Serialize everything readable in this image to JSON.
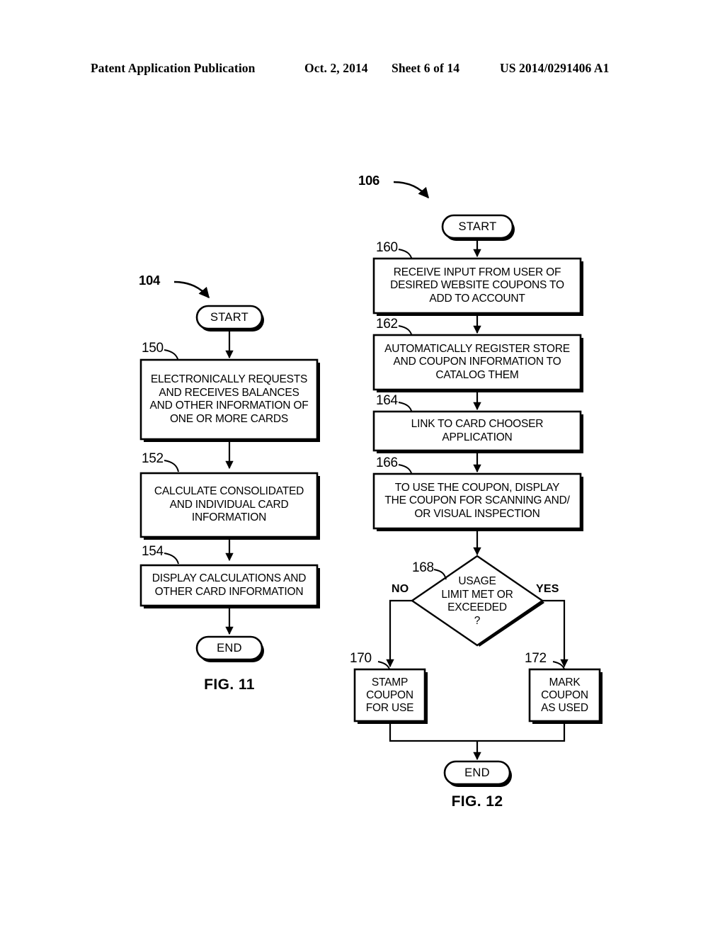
{
  "header": {
    "publication": "Patent Application Publication",
    "date": "Oct. 2, 2014",
    "sheet": "Sheet 6 of 14",
    "patent_number": "US 2014/0291406 A1"
  },
  "figures": [
    {
      "caption": "FIG. 11",
      "diagram_ref": "104",
      "start_label": "START",
      "end_label": "END",
      "steps": [
        {
          "ref": "150",
          "text": "ELECTRONICALLY REQUESTS\nAND RECEIVES BALANCES\nAND OTHER INFORMATION OF\nONE OR MORE CARDS"
        },
        {
          "ref": "152",
          "text": "CALCULATE CONSOLIDATED\nAND INDIVIDUAL CARD\nINFORMATION"
        },
        {
          "ref": "154",
          "text": "DISPLAY CALCULATIONS AND\nOTHER CARD INFORMATION"
        }
      ]
    },
    {
      "caption": "FIG. 12",
      "diagram_ref": "106",
      "start_label": "START",
      "end_label": "END",
      "steps": [
        {
          "ref": "160",
          "text": "RECEIVE INPUT FROM USER OF\nDESIRED WEBSITE COUPONS TO\nADD TO ACCOUNT"
        },
        {
          "ref": "162",
          "text": "AUTOMATICALLY REGISTER STORE\nAND COUPON INFORMATION TO\nCATALOG THEM"
        },
        {
          "ref": "164",
          "text": "LINK TO CARD CHOOSER\nAPPLICATION"
        },
        {
          "ref": "166",
          "text": "TO USE THE COUPON, DISPLAY\nTHE COUPON FOR SCANNING AND/\nOR VISUAL INSPECTION"
        }
      ],
      "decision": {
        "ref": "168",
        "text": "USAGE\nLIMIT MET OR\nEXCEEDED\n?",
        "no_label": "NO",
        "yes_label": "YES"
      },
      "branches": [
        {
          "ref": "170",
          "text": "STAMP\nCOUPON\nFOR USE"
        },
        {
          "ref": "172",
          "text": "MARK\nCOUPON\nAS USED"
        }
      ]
    }
  ],
  "colors": {
    "ink": "#000000",
    "paper": "#ffffff"
  }
}
